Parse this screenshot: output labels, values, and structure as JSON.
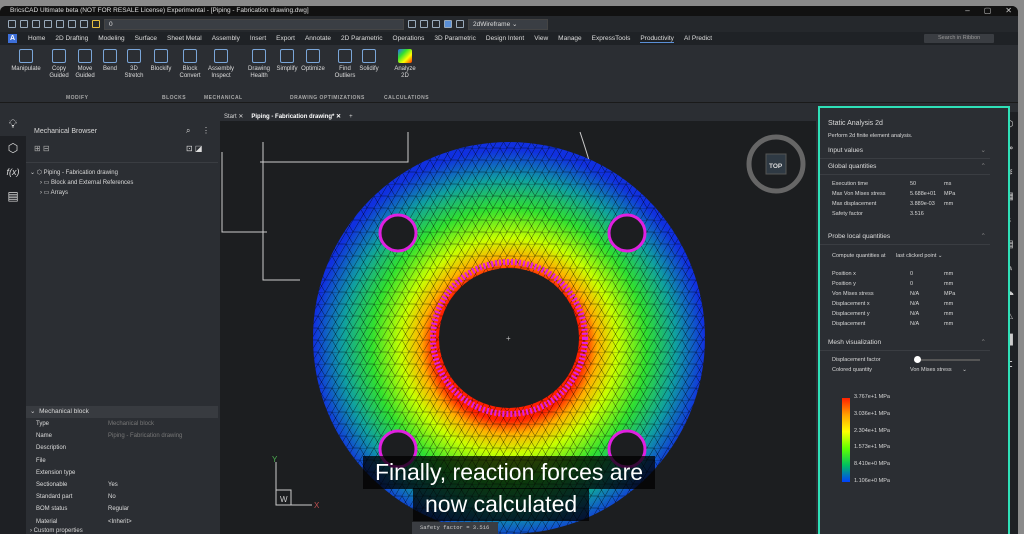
{
  "window": {
    "title": "BricsCAD Ultimate beta (NOT FOR RESALE License) Experimental - [Piping - Fabrication drawing.dwg]",
    "layer": "0",
    "visual_style": "2dWireframe"
  },
  "ribbon_tabs": [
    "Home",
    "2D Drafting",
    "Modeling",
    "Surface",
    "Sheet Metal",
    "Assembly",
    "Insert",
    "Export",
    "Annotate",
    "2D Parametric",
    "Operations",
    "3D Parametric",
    "Design Intent",
    "View",
    "Manage",
    "ExpressTools",
    "Productivity",
    "AI Predict"
  ],
  "active_tab": "Productivity",
  "search_placeholder": "Search in Ribbon",
  "ribbon_buttons": [
    "Manipulate",
    "Copy Guided",
    "Move Guided",
    "Bend",
    "3D Stretch",
    "Blockify",
    "Block Convert",
    "Assembly Inspect",
    "Drawing Health",
    "Simplify",
    "Optimize",
    "Find Outliers",
    "Solidify",
    "Analyze 2D"
  ],
  "ribbon_groups": [
    "MODIFY",
    "BLOCKS",
    "MECHANICAL",
    "DRAWING OPTIMIZATIONS",
    "CALCULATIONS"
  ],
  "browser": {
    "title": "Mechanical Browser",
    "tree": [
      "Piping - Fabrication drawing",
      "Block and External References",
      "Arrays"
    ]
  },
  "props": {
    "header": "Mechanical block",
    "rows": [
      [
        "Type",
        "Mechanical block"
      ],
      [
        "Name",
        "Piping - Fabrication drawing"
      ],
      [
        "Description",
        ""
      ],
      [
        "File",
        ""
      ],
      [
        "Extension type",
        ""
      ],
      [
        "Sectionable",
        "Yes"
      ],
      [
        "Standard part",
        "No"
      ],
      [
        "BOM status",
        "Regular"
      ],
      [
        "Material",
        "<Inherit>"
      ]
    ],
    "more": "Custom properties"
  },
  "doc_tabs": [
    "Start",
    "Piping - Fabrication drawing*"
  ],
  "viewcube": "TOP",
  "ucs": {
    "y": "Y",
    "x": "X",
    "w": "W"
  },
  "command_line": "Safety factor = 3.516",
  "caption": [
    "Finally, reaction forces are",
    "now calculated"
  ],
  "analysis": {
    "title": "Static Analysis 2d",
    "desc": "Perform 2d finite element analysis.",
    "sections": {
      "input": "Input values",
      "global": "Global quantities",
      "probe": "Probe local quantities",
      "mesh": "Mesh visualization"
    },
    "global": [
      [
        "Execution time",
        "50",
        "ms"
      ],
      [
        "Max Von Mises stress",
        "5.688e+01",
        "MPa"
      ],
      [
        "Max displacement",
        "3.889e-03",
        "mm"
      ],
      [
        "Safety factor",
        "3.516",
        ""
      ]
    ],
    "compute_label": "Compute quantities at",
    "compute_value": "last clicked point",
    "probe": [
      [
        "Position x",
        "0",
        "mm"
      ],
      [
        "Position y",
        "0",
        "mm"
      ],
      [
        "Von Mises stress",
        "N/A",
        "MPa"
      ],
      [
        "Displacement x",
        "N/A",
        "mm"
      ],
      [
        "Displacement y",
        "N/A",
        "mm"
      ],
      [
        "Displacement",
        "N/A",
        "mm"
      ]
    ],
    "disp_factor_label": "Displacement factor",
    "disp_factor": 0,
    "colored_label": "Colored quantity",
    "colored_value": "Von Mises stress",
    "legend": [
      "3.767e+1 MPa",
      "3.036e+1 MPa",
      "2.304e+1 MPa",
      "1.573e+1 MPa",
      "8.410e+0 MPa",
      "1.106e+0 MPa"
    ]
  },
  "colors": {
    "accent": "#2fe0b8",
    "tab_underline": "#5a8fd6",
    "bolt": "#e020e0"
  }
}
